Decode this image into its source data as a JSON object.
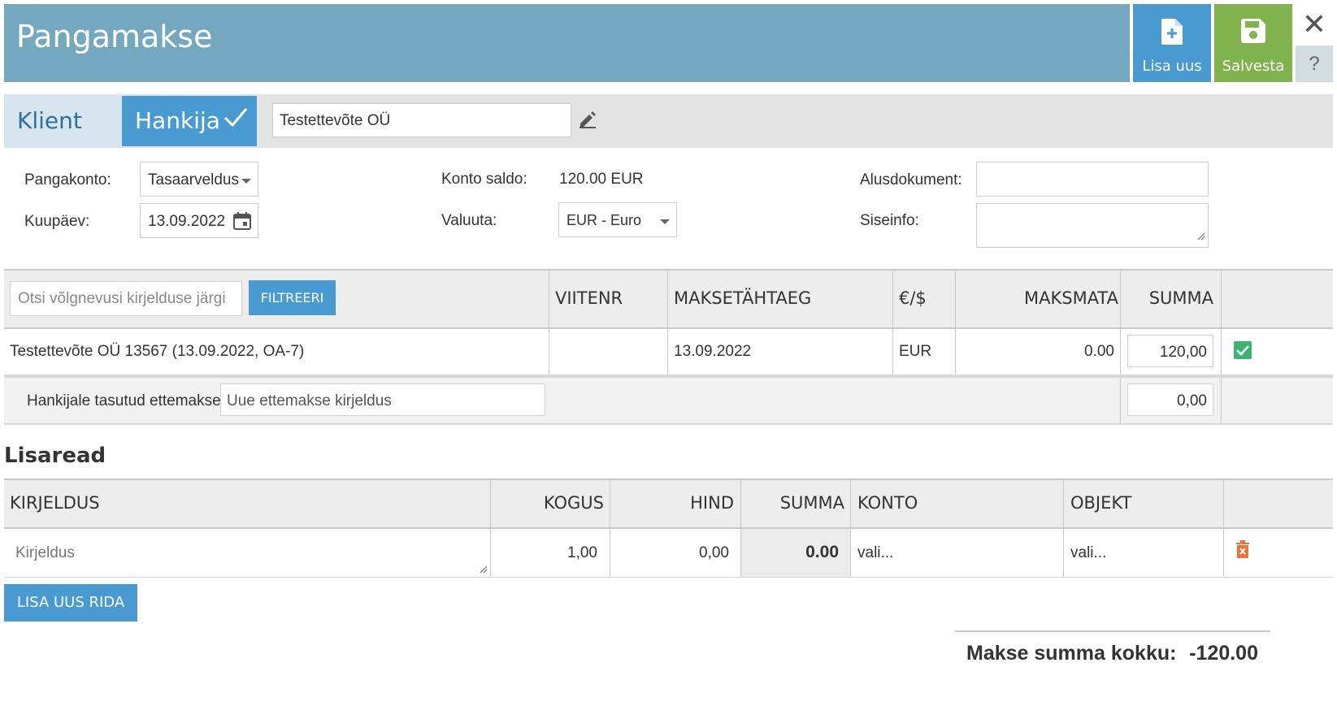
{
  "header": {
    "title": "Pangamakse",
    "new_label": "Lisa uus",
    "save_label": "Salvesta",
    "close_symbol": "✕",
    "help_symbol": "?"
  },
  "party": {
    "client_tab": "Klient",
    "supplier_tab": "Hankija",
    "name": "Testettevõte OÜ"
  },
  "form": {
    "bank_account_label": "Pangakonto:",
    "bank_account_value": "Tasaarveldus",
    "date_label": "Kuupäev:",
    "date_value": "13.09.2022",
    "balance_label": "Konto saldo:",
    "balance_value": "120.00 EUR",
    "currency_label": "Valuuta:",
    "currency_value": "EUR - Euro",
    "basis_doc_label": "Alusdokument:",
    "basis_doc_value": "",
    "internal_info_label": "Siseinfo:",
    "internal_info_value": ""
  },
  "debts": {
    "search_placeholder": "Otsi võlgnevusi kirjelduse järgi",
    "filter_label": "FILTREERI",
    "columns": {
      "ref": "VIITENR",
      "due": "MAKSETÄHTAEG",
      "currency": "€/$",
      "unpaid": "MAKSMATA",
      "sum": "SUMMA"
    },
    "rows": [
      {
        "description": "Testettevõte OÜ 13567 (13.09.2022, OA-7)",
        "ref": "",
        "due": "13.09.2022",
        "currency": "EUR",
        "unpaid": "0.00",
        "sum": "120,00",
        "checked": true
      }
    ],
    "prepayment_label": "Hankijale tasutud ettemakse:",
    "prepayment_placeholder": "Uue ettemakse kirjeldus",
    "prepayment_sum": "0,00"
  },
  "extra": {
    "title": "Lisaread",
    "columns": {
      "description": "KIRJELDUS",
      "qty": "KOGUS",
      "price": "HIND",
      "sum": "SUMMA",
      "account": "KONTO",
      "object": "OBJEKT"
    },
    "rows": [
      {
        "description_placeholder": "Kirjeldus",
        "qty": "1,00",
        "price": "0,00",
        "sum": "0.00",
        "account": "vali...",
        "object": "vali..."
      }
    ],
    "add_row_label": "LISA UUS RIDA"
  },
  "total": {
    "label": "Makse summa kokku:",
    "value": "-120.00"
  },
  "colors": {
    "header": "#73a8bf",
    "blue": "#4a9ad2",
    "green": "#80b24e",
    "delete": "#e8743b"
  }
}
